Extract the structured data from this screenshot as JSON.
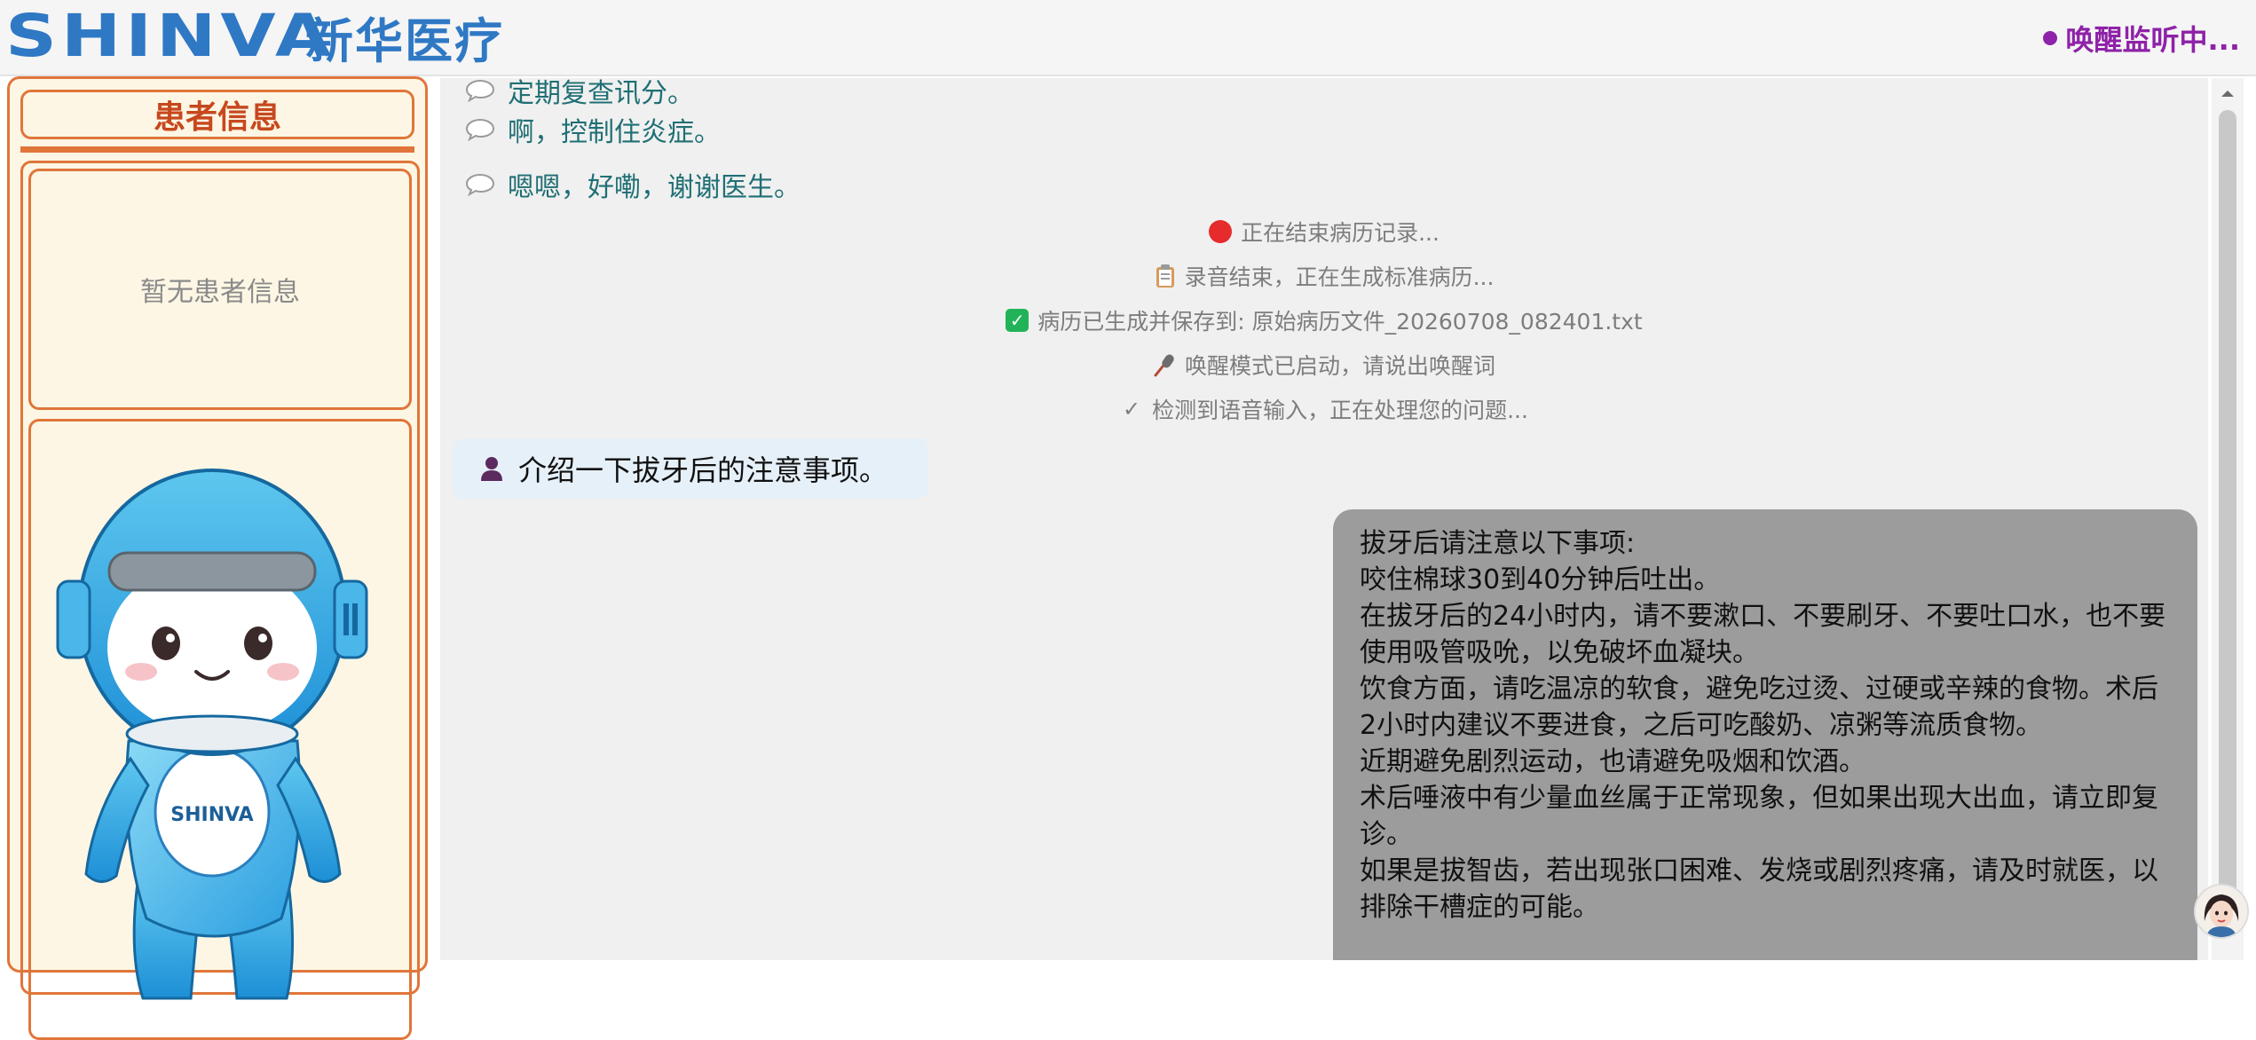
{
  "header": {
    "logo_en": "SHINVA",
    "logo_cn": "新华医疗",
    "wake_status": "唤醒监听中..."
  },
  "sidebar": {
    "title": "患者信息",
    "empty_text": "暂无患者信息",
    "mascot_label": "SHINVA"
  },
  "chat": {
    "partial_line": "定期复查讯分。",
    "patient_lines": [
      "啊，控制住炎症。",
      "嗯嗯，好嘞，谢谢医生。"
    ],
    "system_lines": [
      "正在结束病历记录...",
      "录音结束，正在生成标准病历...",
      "病历已生成并保存到: 原始病历文件_20260708_082401.txt",
      "唤醒模式已启动，请说出唤醒词",
      "检测到语音输入，正在处理您的问题..."
    ],
    "user_question": "介绍一下拔牙后的注意事项。",
    "ai_answer": [
      "拔牙后请注意以下事项:",
      "咬住棉球30到40分钟后吐出。",
      "在拔牙后的24小时内，请不要漱口、不要刷牙、不要吐口水，也不要使用吸管吸吮，以免破坏血凝块。",
      "饮食方面，请吃温凉的软食，避免吃过烫、过硬或辛辣的食物。术后2小时内建议不要进食，之后可吃酸奶、凉粥等流质食物。",
      "近期避免剧烈运动，也请避免吸烟和饮酒。",
      "术后唾液中有少量血丝属于正常现象，但如果出现大出血，请立即复诊。",
      "如果是拔智齿，若出现张口困难、发烧或剧烈疼痛，请及时就医，以排除干槽症的可能。"
    ]
  },
  "colors": {
    "brand_blue": "#2f78c4",
    "wake_purple": "#8e22a8",
    "sidebar_orange": "#e0763a",
    "patient_text_teal": "#1f6f74",
    "ai_bubble_gray": "#9c9c9c"
  },
  "icons": {
    "patient_message": "speech-bubble-icon",
    "recording_stop": "red-dot-icon",
    "recording_end": "clipboard-icon",
    "record_saved": "check-box-icon",
    "wake_mode": "microphone-icon",
    "voice_detected": "check-mark-icon",
    "user": "user-icon",
    "scroll_up": "chevron-up-icon",
    "assistant_avatar": "assistant-avatar-icon"
  }
}
